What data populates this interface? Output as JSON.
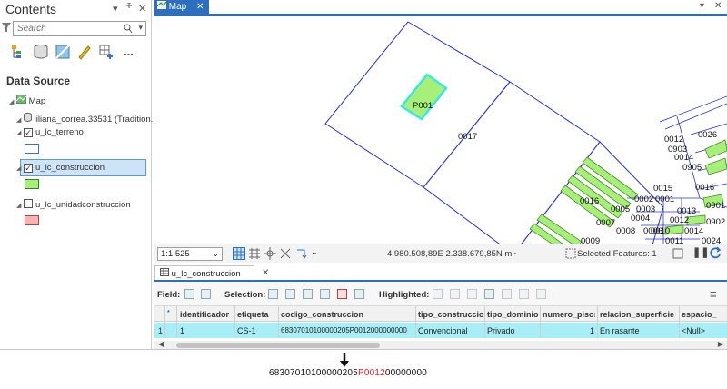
{
  "contents": {
    "title": "Contents",
    "pin_glyph": "▾",
    "close_glyph": "✕",
    "search_placeholder": "Search",
    "toolbar_more": "...",
    "data_source_label": "Data Source",
    "tree": {
      "map": "Map",
      "database": "liliana_correa.33531 (Tradition...",
      "layers": [
        {
          "name": "u_lc_terreno",
          "checked": true,
          "swatch_fill": "#ffffff",
          "swatch_stroke": "#3a6fd0"
        },
        {
          "name": "u_lc_construccion",
          "checked": true,
          "selected": true,
          "swatch_fill": "#a6f07a",
          "swatch_stroke": "#3a7d2a"
        },
        {
          "name": "u_lc_unidadconstruccion",
          "checked": false,
          "swatch_fill": "#f7b3b3",
          "swatch_stroke": "#c04040"
        }
      ]
    }
  },
  "map_view": {
    "tab_label": "Map",
    "parcel_labels": [
      "P001",
      "0017",
      "0016",
      "0015",
      "0002",
      "0001",
      "0005",
      "0003",
      "0004",
      "0007",
      "0008",
      "0006",
      "0009",
      "0010",
      "0012",
      "0014",
      "0011",
      "0013",
      "0024",
      "0012",
      "0903",
      "0014",
      "0905",
      "0026",
      "0016",
      "0901",
      "0902"
    ],
    "colors": {
      "parcel_stroke": "#2a32d8",
      "building_fill": "#a6f07a",
      "building_stroke": "#4a8a2a",
      "selected_stroke": "#38e6e6",
      "selection_tab": "#2b6fbe"
    }
  },
  "status_bar": {
    "scale": "1:1.525",
    "coordinates": "4.980.508,89E 2.338.679,85N m",
    "selected_features": "Selected Features: 1"
  },
  "attribute_table": {
    "tab_label": "u_lc_construccion",
    "toolbar": {
      "field_label": "Field:",
      "selection_label": "Selection:",
      "highlighted_label": "Highlighted:"
    },
    "columns": [
      "identificador",
      "etiqueta",
      "codigo_construccion",
      "tipo_construccion",
      "tipo_dominio",
      "numero_pisos",
      "relacion_superficie",
      "espacio_"
    ],
    "rows": [
      {
        "row_num": "1",
        "cells": [
          "1",
          "CS-1",
          "68307010100000205P0012000000000",
          "Convencional",
          "Privado",
          "1",
          "En rasante",
          "<Null>"
        ]
      }
    ]
  },
  "annotation": {
    "arrow": "🠗",
    "code_prefix": "68307010100000205",
    "code_highlight": "P0012",
    "code_suffix": "00000000"
  }
}
